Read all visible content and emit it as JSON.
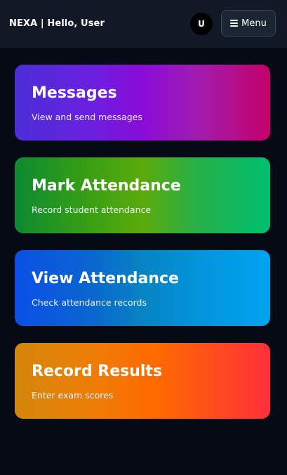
{
  "header": {
    "brand": "NEXA | Hello, User",
    "avatar_initial": "U",
    "menu_label": "Menu",
    "menu_icon": "hamburger-icon"
  },
  "cards": [
    {
      "title": "Messages",
      "description": "View and send messages"
    },
    {
      "title": "Mark Attendance",
      "description": "Record student attendance"
    },
    {
      "title": "View Attendance",
      "description": "Check attendance records"
    },
    {
      "title": "Record Results",
      "description": "Enter exam scores"
    }
  ],
  "colors": {
    "background": "#050a14",
    "header": "#111826",
    "messages_gradient": [
      "#4a2fd6",
      "#8a0cd8",
      "#c5006a"
    ],
    "mark_attendance_gradient": [
      "#0c8a30",
      "#5caa0b",
      "#00bf6f"
    ],
    "view_attendance_gradient": [
      "#0a4fe6",
      "#0684c2",
      "#00a4ee"
    ],
    "record_results_gradient": [
      "#d4860a",
      "#ff6a00",
      "#ff2e3a"
    ]
  }
}
